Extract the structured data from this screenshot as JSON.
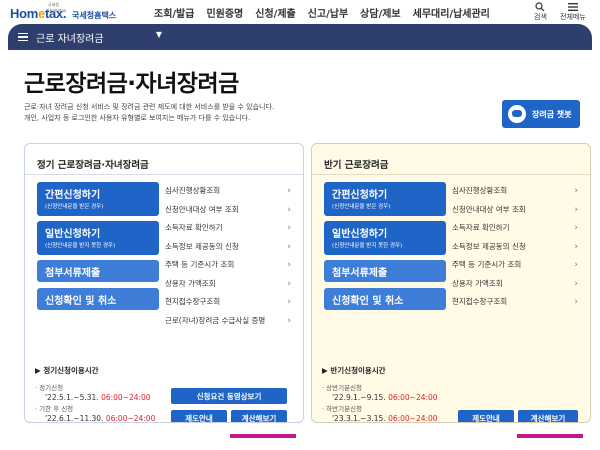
{
  "header": {
    "logo_small": "국세청 Hometax",
    "logo_text_pre": "Hom",
    "logo_text_dot": "e",
    "logo_text_post": "tax.",
    "logo_sub": "국세청홈택스",
    "gnb": [
      "조회/발급",
      "민원증명",
      "신청/제출",
      "신고/납부",
      "상담/제보",
      "세무대리/납세관리"
    ],
    "tools": {
      "search": "검색",
      "allmenu": "전체메뉴"
    }
  },
  "subnav": {
    "current": "근로 자녀장려금"
  },
  "page": {
    "title": "근로장려금·자녀장려금",
    "desc_line1": "근로·자녀 장려금 신청 서비스 및 장려금 관련 제도에 대한 서비스를 받을 수 있습니다.",
    "desc_line2": "개인, 사업자 등 로그인한 사용자 유형별로 보여지는 메뉴가 다를 수 있습니다.",
    "chatbot": "장려금 챗봇"
  },
  "left_panel": {
    "title": "정기 근로장려금·자녀장려금",
    "btn_easy": "간편신청하기",
    "btn_easy_sub": "(신청안내문을 받은 경우)",
    "btn_general": "일반신청하기",
    "btn_general_sub": "(신청안내문을 받지 못한 경우)",
    "btn_docs": "첨부서류제출",
    "btn_confirm": "신청확인 및 취소",
    "menu": [
      "심사진행상황조회",
      "신청안내대상 여부 조회",
      "소득자료 확인하기",
      "소득정보 제공동의 신청",
      "주택 등 기준시가 조회",
      "상용자 가액조회",
      "현지접수창구조회",
      "근로(자녀)장려금 수급사실 증명"
    ],
    "hours_title": "▶ 정기신청이용시간",
    "period1_label": "· 정기신청",
    "period1_date": "'22.5.1.~5.31.",
    "period1_time": "06:00~24:00",
    "period2_label": "· 기한 후 신청",
    "period2_date": "'22.6.1.~11.30.",
    "period2_time": "06:00~24:00",
    "btn_video": "신청요건 동영상보기",
    "btn_guide": "제도안내",
    "btn_calc": "계산해보기"
  },
  "right_panel": {
    "title": "반기 근로장려금",
    "btn_easy": "간편신청하기",
    "btn_easy_sub": "(신청안내문을 받은 경우)",
    "btn_general": "일반신청하기",
    "btn_general_sub": "(신청안내문을 받지 못한 경우)",
    "btn_docs": "첨부서류제출",
    "btn_confirm": "신청확인 및 취소",
    "menu": [
      "심사진행상황조회",
      "신청안내대상 여부 조회",
      "소득자료 확인하기",
      "소득정보 제공동의 신청",
      "주택 등 기준시가 조회",
      "상용자 가액조회",
      "현지접수창구조회"
    ],
    "hours_title": "▶ 반기신청이용시간",
    "period1_label": "· 상반기분신청",
    "period1_date": "'22.9.1.~9.15.",
    "period1_time": "06:00~24:00",
    "period2_label": "· 하반기분신청",
    "period2_date": "'23.3.1.~3.15.",
    "period2_time": "06:00~24:00",
    "btn_guide": "제도안내",
    "btn_calc": "계산해보기"
  },
  "colors": {
    "primary": "#1f65c8",
    "nav": "#2e3f6d",
    "accent_underline": "#c2188f",
    "time_red": "#e0222a",
    "right_bg": "#fffbe6"
  }
}
